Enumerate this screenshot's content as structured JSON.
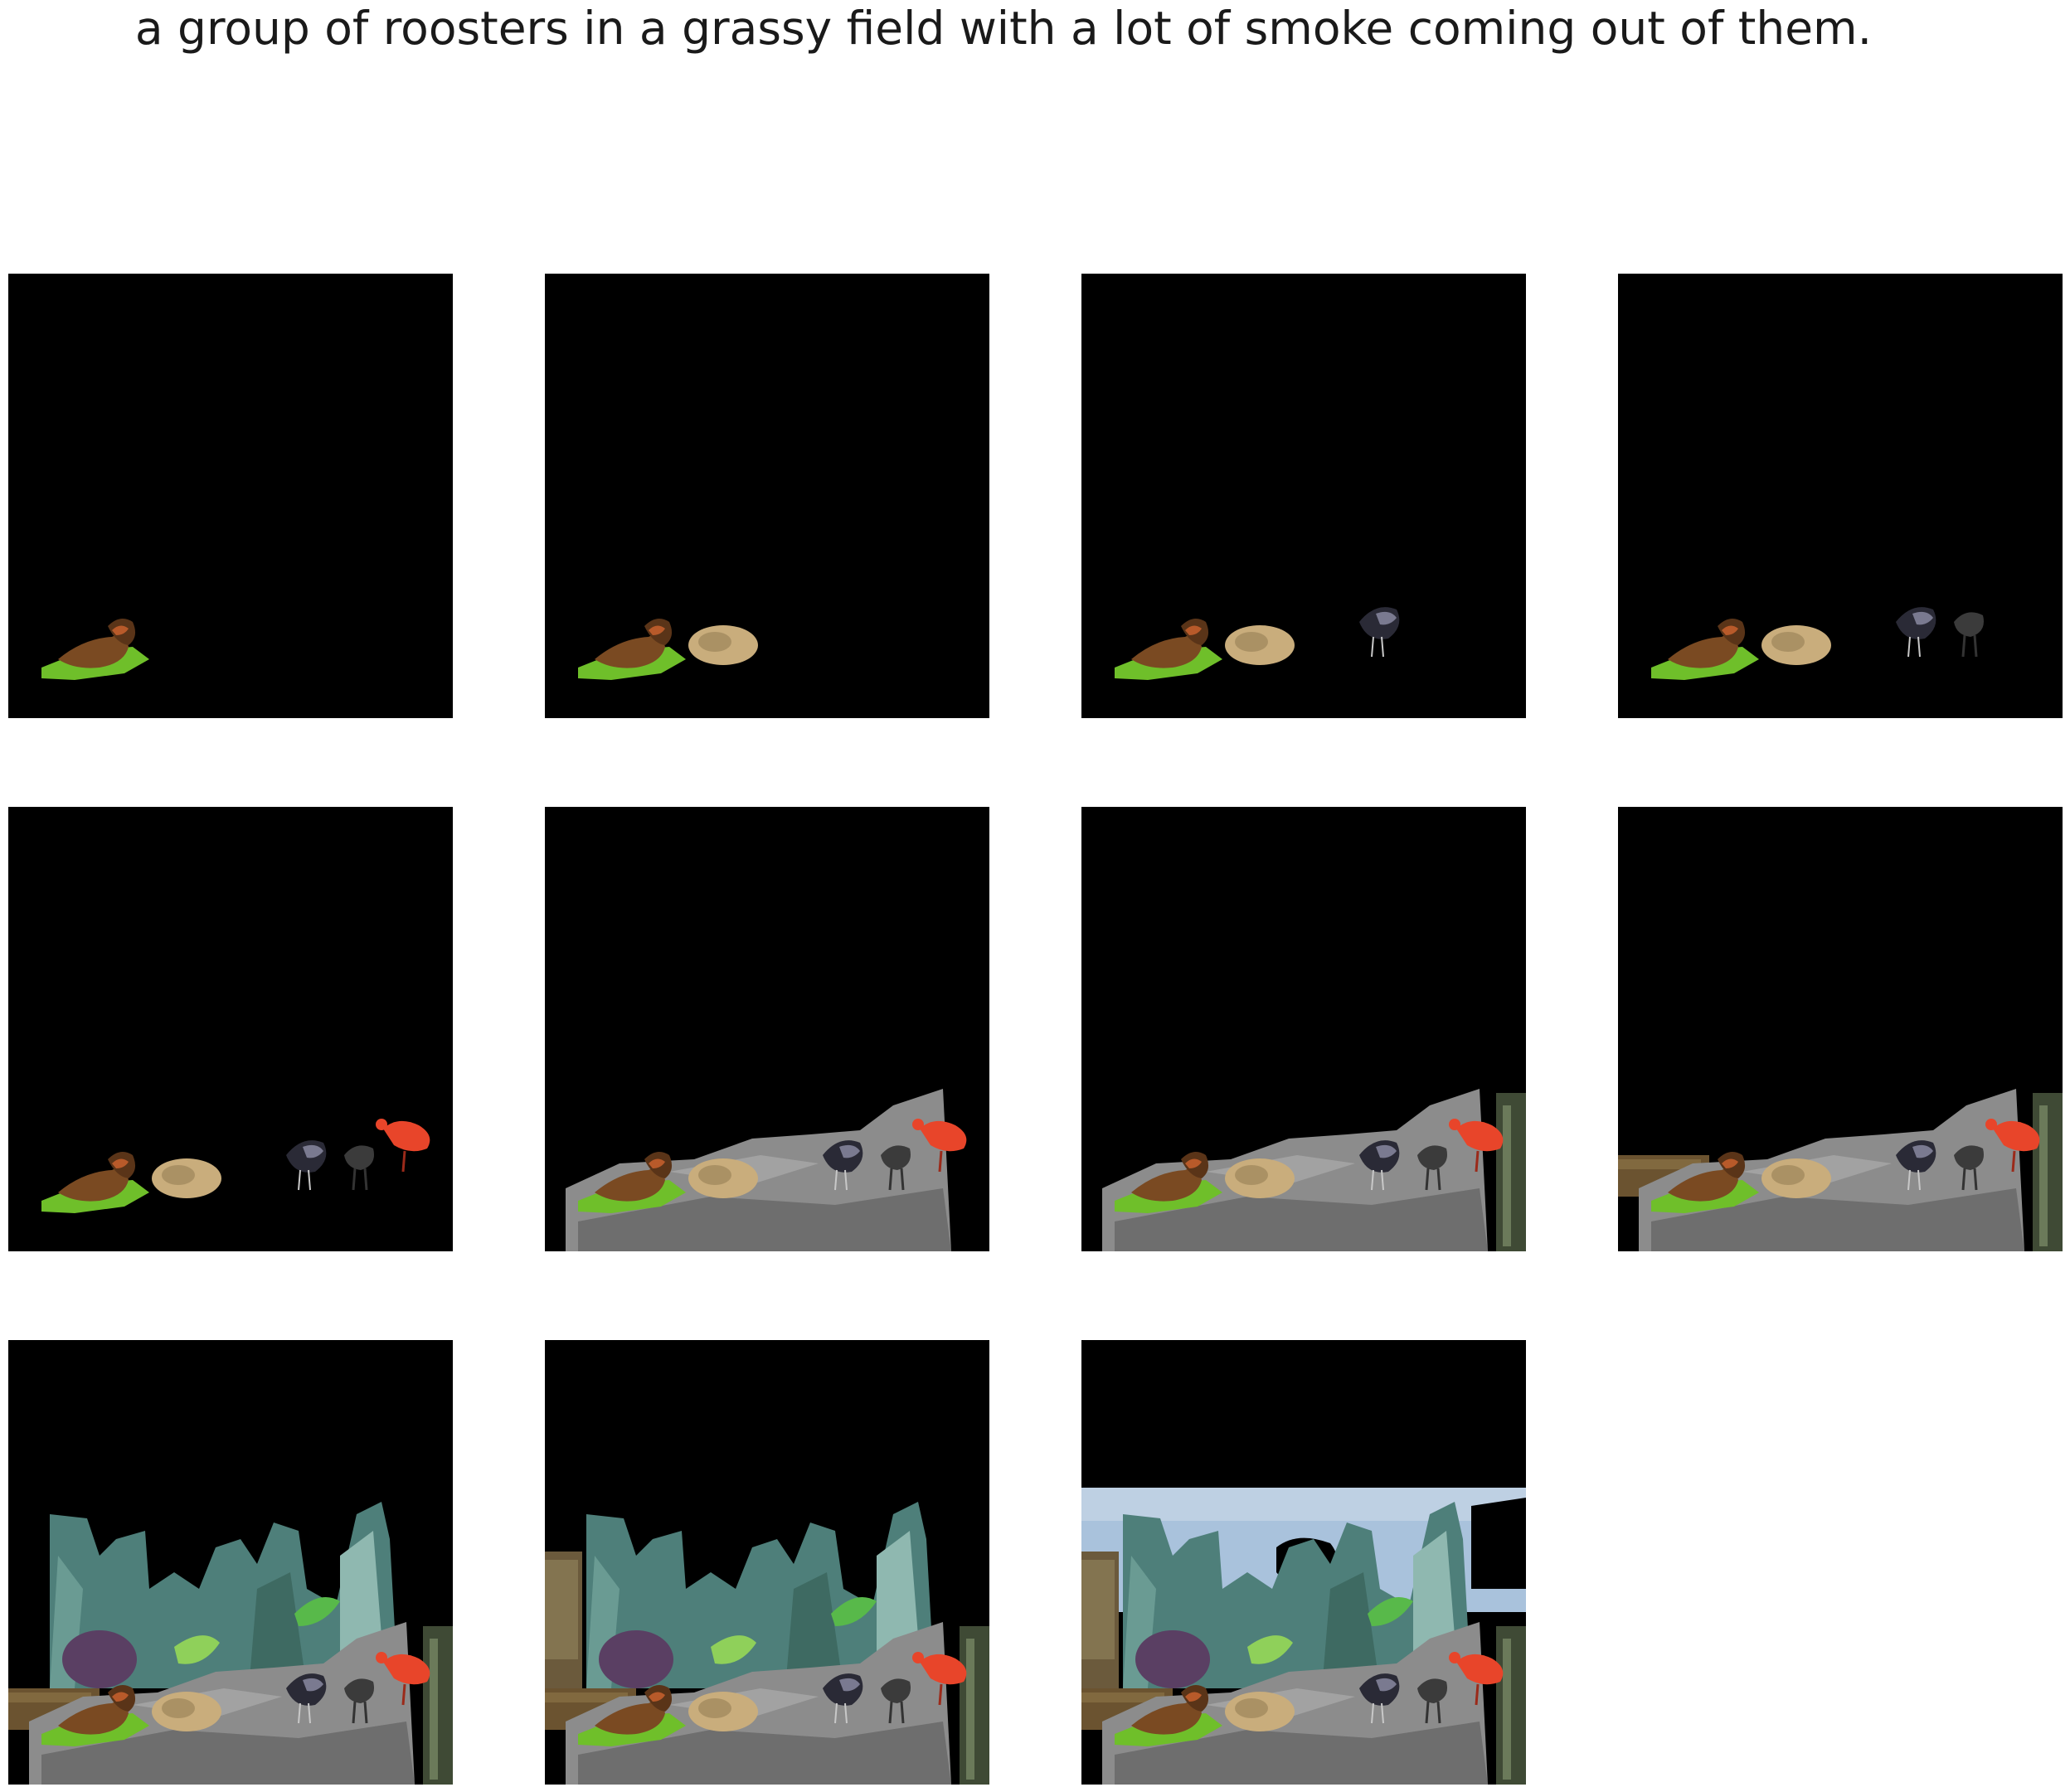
{
  "caption": "a group of roosters in a grassy field with a lot of smoke coming out of them.",
  "panel_count": 11,
  "colors": {
    "page_background": "#ffffff",
    "panel_background": "#000000",
    "grass_green": "#6fbf2a",
    "rooster_brown": "#7a4a22",
    "bird_red": "#e8452a",
    "ground_gray": "#8c8c8c",
    "trees_teal": "#4e7f7a",
    "sky_blue": "#a9c2dc"
  },
  "objects": [
    {
      "name": "rooster-on-grass",
      "first_panel": 1
    },
    {
      "name": "tan-bird",
      "first_panel": 2
    },
    {
      "name": "dark-bird",
      "first_panel": 3
    },
    {
      "name": "ostrich",
      "first_panel": 4
    },
    {
      "name": "red-bird",
      "first_panel": 5
    },
    {
      "name": "gray-ground",
      "first_panel": 6
    },
    {
      "name": "right-strip",
      "first_panel": 7
    },
    {
      "name": "left-field",
      "first_panel": 8
    },
    {
      "name": "trees",
      "first_panel": 9
    },
    {
      "name": "left-tree-patch",
      "first_panel": 10
    },
    {
      "name": "sky",
      "first_panel": 11
    }
  ]
}
